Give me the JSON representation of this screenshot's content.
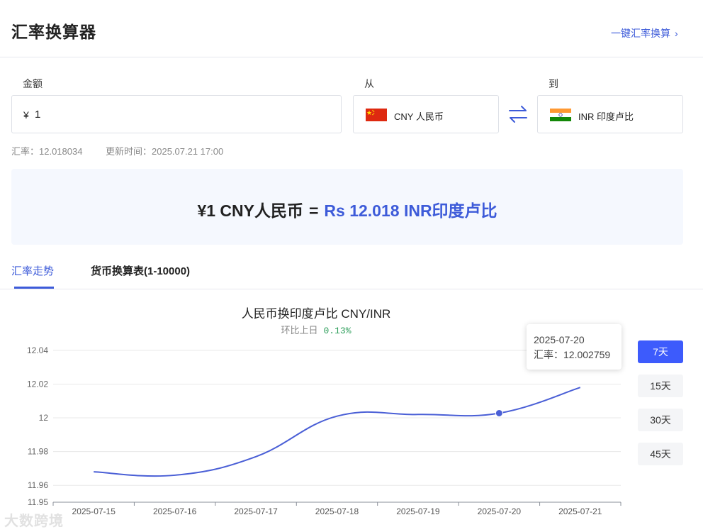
{
  "header": {
    "title": "汇率换算器",
    "quick_link": "一键汇率换算"
  },
  "form": {
    "amount_label": "金额",
    "amount_symbol": "¥",
    "amount_value": "1",
    "from_label": "从",
    "to_label": "到",
    "from_currency": "CNY  人民币",
    "to_currency": "INR  印度卢比",
    "from_flag": "china-flag",
    "to_flag": "india-flag"
  },
  "meta": {
    "rate_label": "汇率：12.018034",
    "updated_label": "更新时间：2025.07.21 17:00"
  },
  "result": {
    "lhs": "¥1 CNY人民币",
    "eq": "=",
    "rhs": "Rs 12.018  INR印度卢比"
  },
  "tabs": [
    {
      "label": "汇率走势",
      "active": true
    },
    {
      "label": "货币换算表(1-10000)",
      "active": false
    }
  ],
  "chart": {
    "title": "人民币换印度卢比   CNY/INR",
    "sub_label": "环比上日",
    "sub_change": "0.13%",
    "tooltip_date": "2025-07-20",
    "tooltip_rate": "汇率：12.002759",
    "range_buttons": [
      {
        "label": "7天",
        "active": true
      },
      {
        "label": "15天",
        "active": false
      },
      {
        "label": "30天",
        "active": false
      },
      {
        "label": "45天",
        "active": false
      }
    ]
  },
  "chart_data": {
    "type": "line",
    "title": "人民币换印度卢比   CNY/INR",
    "x": [
      "2025-07-15",
      "2025-07-16",
      "2025-07-17",
      "2025-07-18",
      "2025-07-19",
      "2025-07-20",
      "2025-07-21"
    ],
    "series": [
      {
        "values": [
          11.968,
          11.966,
          11.977,
          12.001,
          12.002,
          12.002759,
          12.018034
        ]
      }
    ],
    "y_ticks": [
      "12.04",
      "12.02",
      "12",
      "11.98",
      "11.96",
      "11.95"
    ],
    "ylim": [
      11.95,
      12.045
    ],
    "grid": true,
    "highlight_index": 5,
    "line_color": "#4a5fd6"
  },
  "watermark": "大数跨境"
}
